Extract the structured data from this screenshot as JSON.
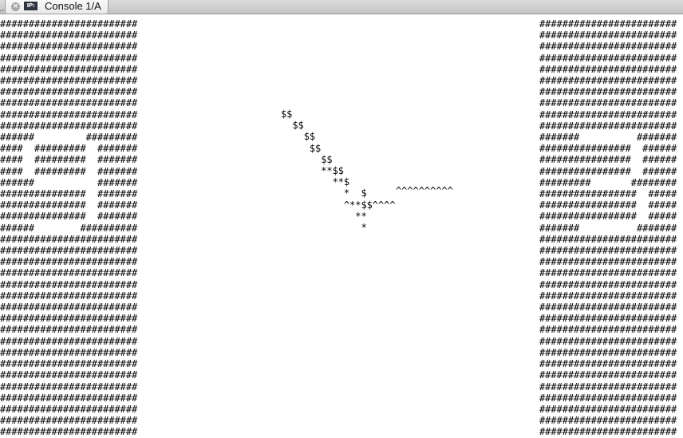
{
  "tab": {
    "label": "Console 1/A",
    "icon_text": "IP:",
    "close_glyph": "×"
  },
  "icons": [
    "chevron-left-icon",
    "close-icon",
    "ipython-console-icon"
  ],
  "console": {
    "left_wall": "########################\n########################\n########################\n########################\n########################\n########################\n########################\n########################\n########################\n########################\n######         #########\n####  #########  #######\n####  #########  #######\n####  #########  #######\n######           #######\n###############  #######\n###############  #######\n###############  #######\n######        ##########\n########################\n########################\n########################\n########################\n########################\n########################\n########################\n########################\n########################\n########################\n########################\n########################\n########################\n########################\n########################\n########################\n########################\n########################",
    "right_wall": "########################\n########################\n########################\n########################\n########################\n########################\n########################\n########################\n########################\n########################\n#######          #######\n################  ######\n################  ######\n################  ######\n#########       ########\n#################  #####\n#################  #####\n#################  #####\n#######          #######\n########################\n########################\n########################\n########################\n########################\n########################\n########################\n########################\n########################\n########################\n########################\n########################\n########################\n########################\n########################\n########################\n########################\n########################",
    "trail": "$$\n  $$\n    $$\n     $$\n       $$\n       **$$\n         **$\n           *  $\n           ^**$$^^^^\n             **\n              *",
    "caret_line": "^^^^^^^^^^"
  }
}
